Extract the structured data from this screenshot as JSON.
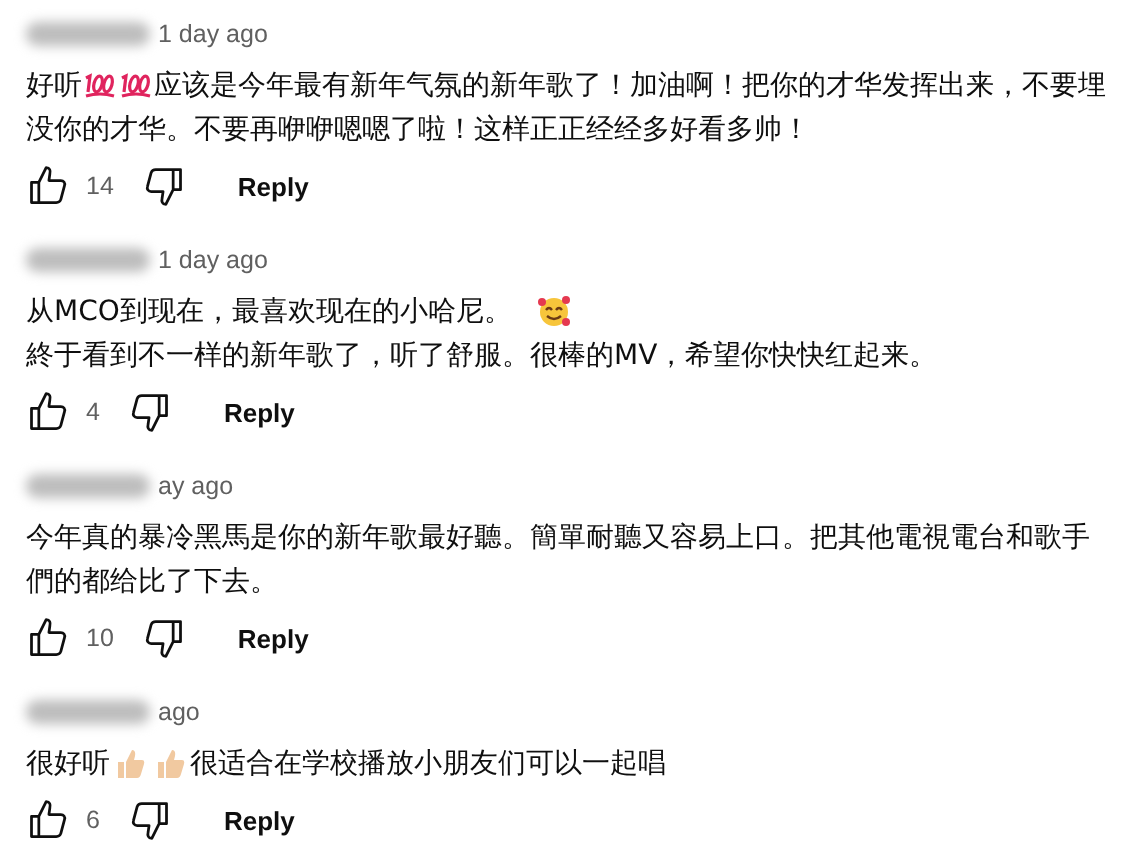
{
  "comments": [
    {
      "time": "1 day ago",
      "lines": [
        [
          {
            "kind": "text",
            "text": "好听"
          },
          {
            "kind": "hundred"
          },
          {
            "kind": "hundred"
          },
          {
            "kind": "text",
            "text": "应该是今年最有新年气氛的新年歌了！加油啊！把你的才华发挥出来，不要埋"
          }
        ],
        [
          {
            "kind": "text",
            "text": "没你的才华。不要再咿咿嗯嗯了啦！这样正正经经多好看多帅！"
          }
        ]
      ],
      "likes": "14",
      "reply": "Reply"
    },
    {
      "time": "1 day ago",
      "lines": [
        [
          {
            "kind": "text",
            "text": "从MCO到现在，最喜欢现在的小哈尼。"
          },
          {
            "kind": "smiley"
          }
        ],
        [
          {
            "kind": "text",
            "text": "終于看到不一样的新年歌了，听了舒服。很棒的MV，希望你快快红起来。"
          }
        ]
      ],
      "likes": "4",
      "reply": "Reply"
    },
    {
      "time": "ay ago",
      "lines": [
        [
          {
            "kind": "text",
            "text": "今年真的暴冷黑馬是你的新年歌最好聽。簡單耐聽又容易上口。把其他電視電台和歌手"
          }
        ],
        [
          {
            "kind": "text",
            "text": "們的都给比了下去。"
          }
        ]
      ],
      "likes": "10",
      "reply": "Reply"
    },
    {
      "time": "ago",
      "lines": [
        [
          {
            "kind": "text",
            "text": "很好听"
          },
          {
            "kind": "thumbs"
          },
          {
            "kind": "thumbs"
          },
          {
            "kind": "text",
            "text": "很适合在学校播放小朋友们可以一起唱"
          }
        ]
      ],
      "likes": "6",
      "reply": "Reply"
    }
  ]
}
